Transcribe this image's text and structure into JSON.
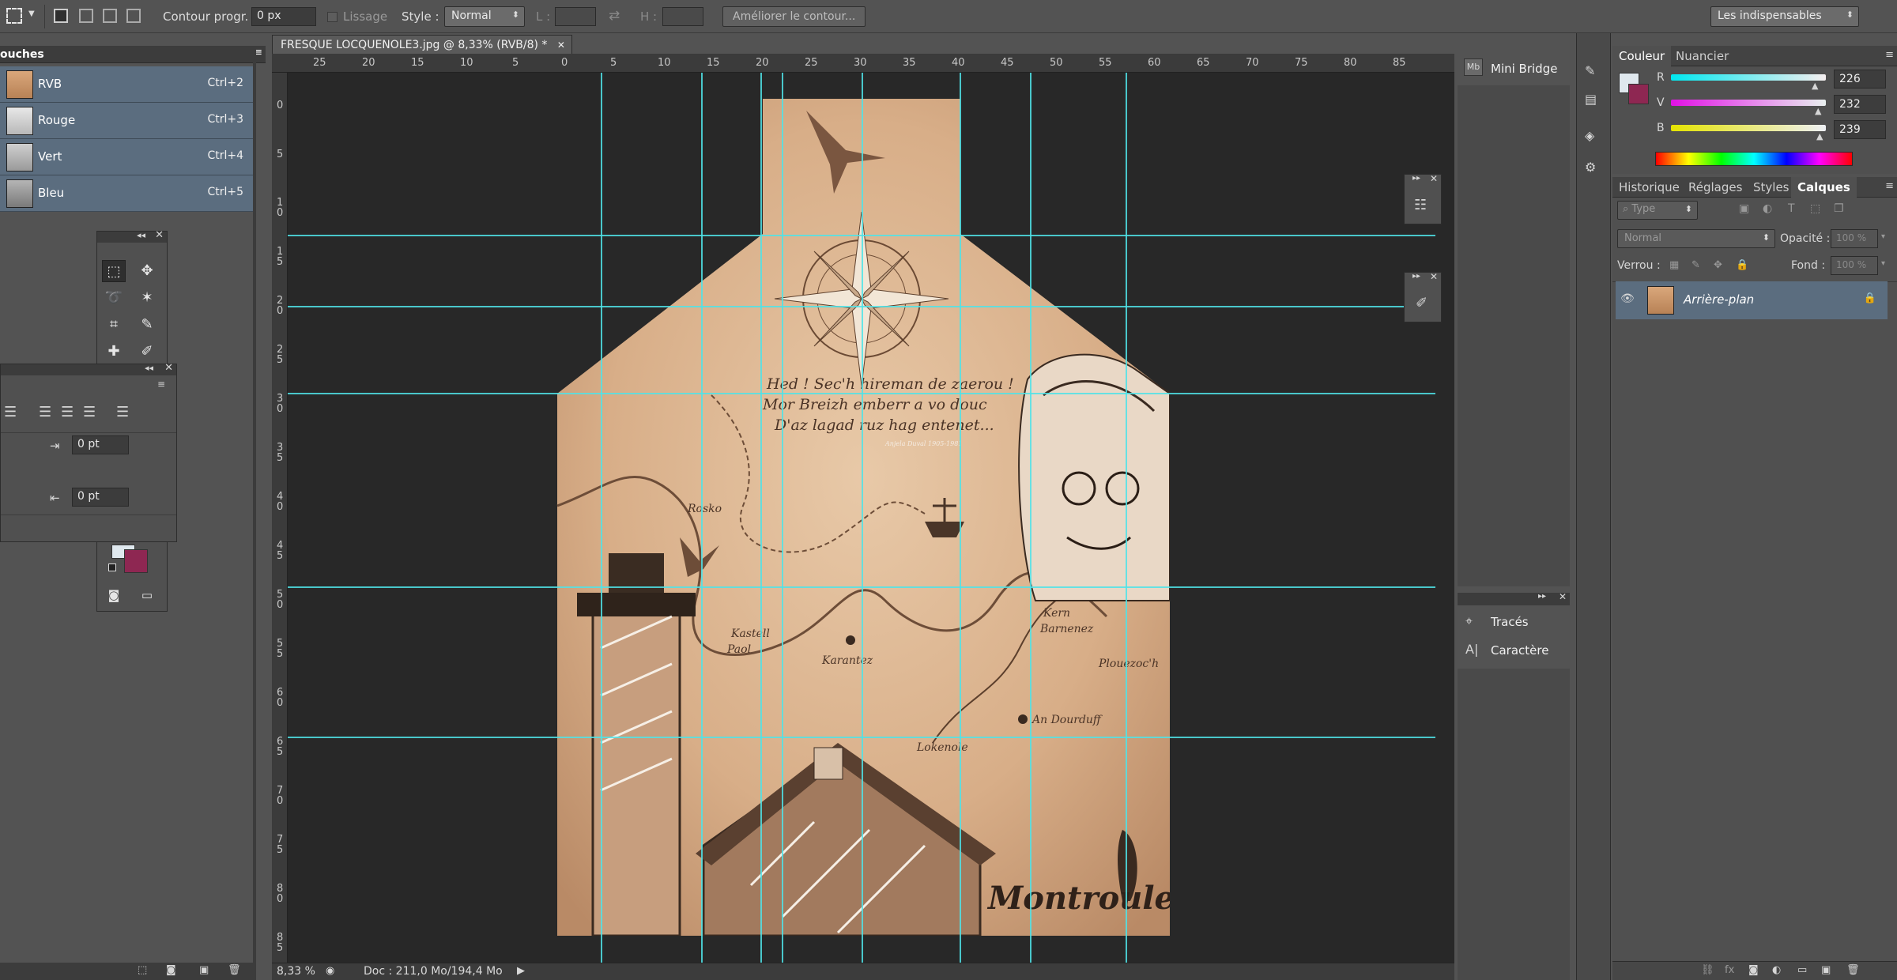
{
  "options_bar": {
    "feather_label": "Contour progr. :",
    "feather_value": "0 px",
    "antialias_label": "Lissage",
    "style_label": "Style :",
    "style_value": "Normal",
    "width_label": "L :",
    "height_label": "H :",
    "refine_button": "Améliorer le contour...",
    "workspace_value": "Les indispensables"
  },
  "channels_panel": {
    "title": "ouches",
    "rows": [
      {
        "name": "RVB",
        "shortcut": "Ctrl+2"
      },
      {
        "name": "Rouge",
        "shortcut": "Ctrl+3"
      },
      {
        "name": "Vert",
        "shortcut": "Ctrl+4"
      },
      {
        "name": "Bleu",
        "shortcut": "Ctrl+5"
      }
    ]
  },
  "paragraph_panel": {
    "space_before": "0 pt",
    "space_after": "0 pt"
  },
  "document": {
    "tab_title": "FRESQUE LOCQUENOLE3.jpg @ 8,33% (RVB/8) *",
    "zoom": "8,33 %",
    "doc_info": "Doc : 211,0 Mo/194,4 Mo"
  },
  "ruler": {
    "h_labels": [
      "25",
      "20",
      "15",
      "10",
      "5",
      "0",
      "5",
      "10",
      "15",
      "20",
      "25",
      "30",
      "35",
      "40",
      "45",
      "50",
      "55",
      "60",
      "65",
      "70",
      "75",
      "80",
      "85"
    ],
    "v_labels": [
      "0",
      "5",
      "1\n0",
      "1\n5",
      "2\n0",
      "2\n5",
      "3\n0",
      "3\n5",
      "4\n0",
      "4\n5",
      "5\n0",
      "5\n5",
      "6\n0",
      "6\n5",
      "7\n0",
      "7\n5",
      "8\n0",
      "8\n5"
    ]
  },
  "artwork": {
    "poem_line1": "Hed ! Sec'h hireman de zaerou !",
    "poem_line2": "Mor Breizh emberr a vo douc",
    "poem_line3": "D'az lagad ruz hag entenet...",
    "signature": "Anjela Duval 1905-1981",
    "place_roscoff": "Rosko",
    "place_kastell": "Kastell\nPaol",
    "place_karantez": "Karantez",
    "place_ker": "Kern\nBarnenez",
    "place_plouezoch": "Plouezoc'h",
    "place_dourduff": "An Dourduff",
    "place_lokenole": "Lokenole",
    "brand": "Montroulez"
  },
  "mid_panel": {
    "mini_bridge": "Mini Bridge",
    "paths": "Tracés",
    "character": "Caractère"
  },
  "color_panel": {
    "tabs": [
      "Couleur",
      "Nuancier"
    ],
    "r_label": "R",
    "r_value": "226",
    "g_label": "V",
    "g_value": "232",
    "b_label": "B",
    "b_value": "239"
  },
  "layers_panel": {
    "tabs": [
      "Historique",
      "Réglages",
      "Styles",
      "Calques"
    ],
    "filter_value": "Type",
    "blend_value": "Normal",
    "opacity_label": "Opacité :",
    "opacity_value": "100 %",
    "lock_label": "Verrou :",
    "fill_label": "Fond :",
    "fill_value": "100 %",
    "layer_name": "Arrière-plan"
  },
  "colors": {
    "guide": "#4fe3e8",
    "selected_row": "#5b6d7f",
    "foreground_swatch": "#dfe8ee",
    "background_swatch": "#8e2752"
  }
}
